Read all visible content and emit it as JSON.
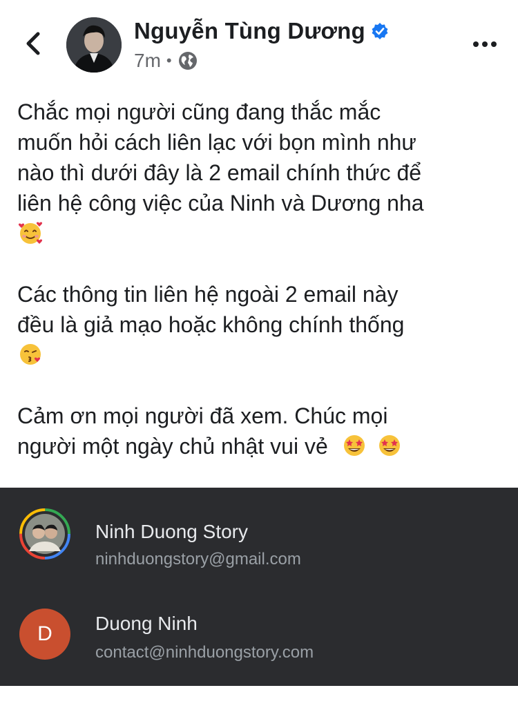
{
  "header": {
    "author_name": "Nguyễn Tùng Dương",
    "timestamp": "7m",
    "separator": "•",
    "audience_icon": "globe-icon",
    "verified_icon": "verified-badge-icon",
    "back_icon": "chevron-left-icon",
    "more_icon": "more-horizontal-icon"
  },
  "post": {
    "paragraphs": [
      {
        "lines": [
          "Chắc mọi người cũng đang thắc mắc",
          "muốn hỏi cách liên lạc với bọn mình như",
          "nào thì dưới đây là 2 email chính thức để",
          "liên hệ công việc của Ninh và Dương nha"
        ],
        "emoji": "smiling-face-with-hearts"
      },
      {
        "lines": [
          "Các thông tin liên hệ ngoài 2 email này",
          "đều là giả mạo hoặc không chính thống"
        ],
        "emoji": "face-blowing-a-kiss"
      },
      {
        "lines": [
          "Cảm ơn mọi người đã xem. Chúc mọi",
          "người một ngày chủ nhật vui vẻ"
        ],
        "emoji": "star-struck x2"
      }
    ]
  },
  "contacts": [
    {
      "name": "Ninh Duong Story",
      "email": "ninhduongstory@gmail.com",
      "avatar": "photo-avatar"
    },
    {
      "name": "Duong Ninh",
      "email": "contact@ninhduongstory.com",
      "avatar_letter": "D"
    }
  ],
  "colors": {
    "text": "#1c1e21",
    "meta": "#65676b",
    "verified": "#1877f2",
    "contacts_bg": "#2b2c2f",
    "contact_name": "#e8eaed",
    "contact_email": "#9aa0a6",
    "letter_avatar": "#c94f2f"
  }
}
